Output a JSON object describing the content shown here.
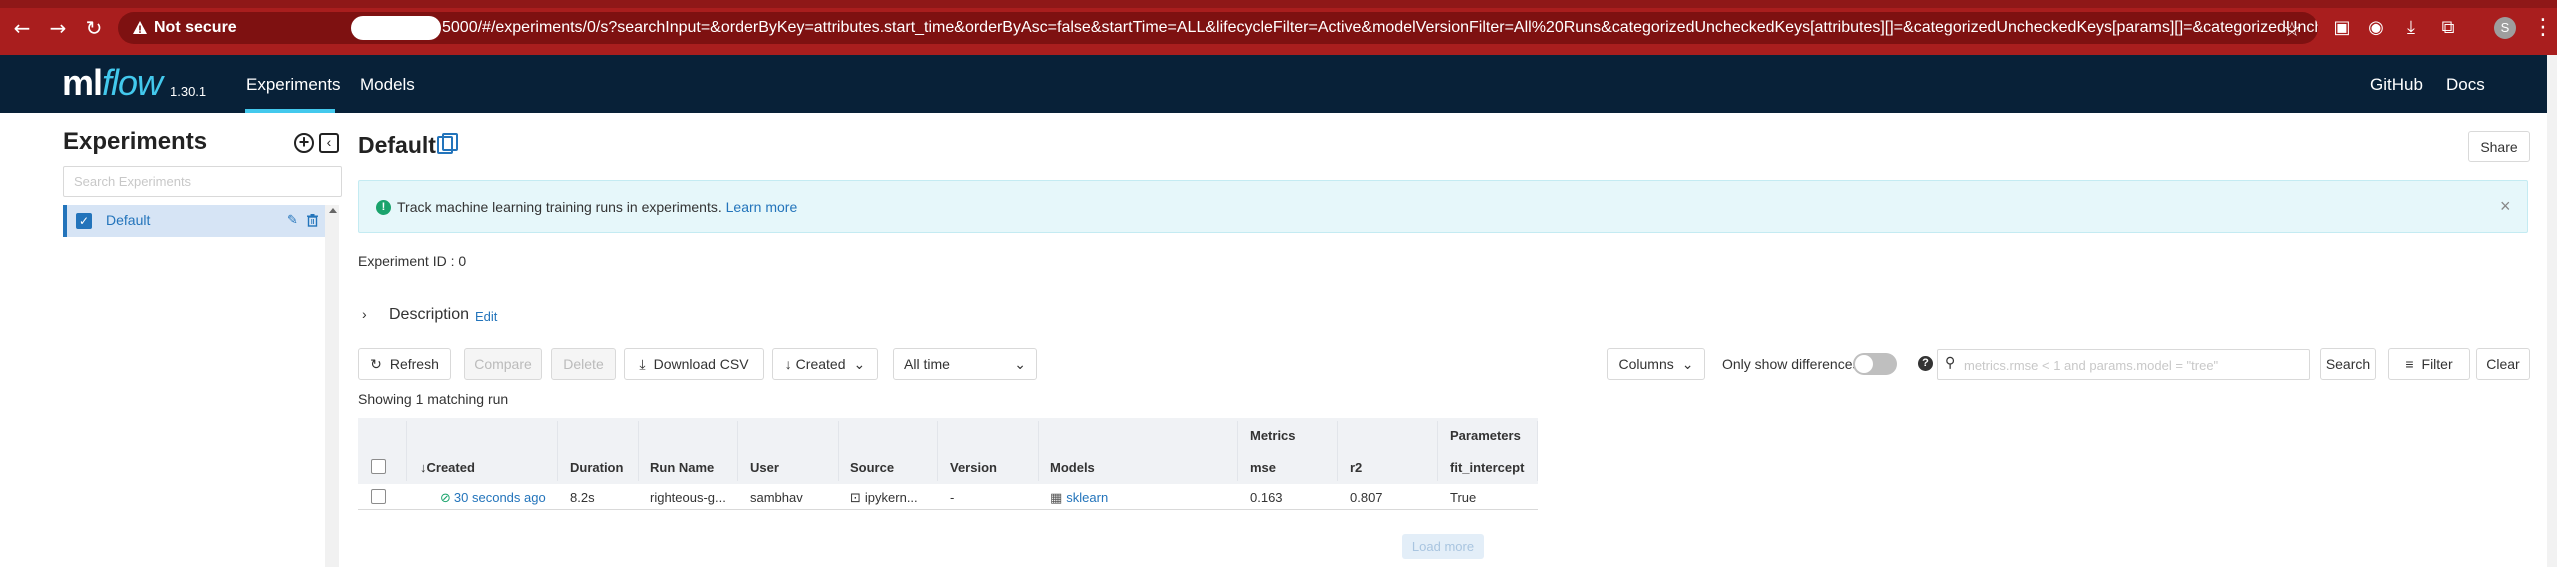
{
  "browser": {
    "not_secure": "Not secure",
    "url": "5000/#/experiments/0/s?searchInput=&orderByKey=attributes.start_time&orderByAsc=false&startTime=ALL&lifecycleFilter=Active&modelVersionFilter=All%20Runs&categorizedUncheckedKeys[attributes][]=&categorizedUncheckedKeys[params][]=&categorizedUncheckedKeys[metrics][]=&categorized...",
    "profile_initial": "S",
    "icons": [
      "back-icon",
      "forward-icon",
      "reload-icon",
      "star-icon",
      "extension-icon",
      "download-icon",
      "puzzle-icon",
      "kebab-icon"
    ]
  },
  "header": {
    "logo_ml": "ml",
    "logo_flow": "flow",
    "version": "1.30.1",
    "nav": [
      "Experiments",
      "Models"
    ],
    "right": [
      "GitHub",
      "Docs"
    ],
    "brand_color": "#082138",
    "accent_color": "#43c9ed"
  },
  "sidebar": {
    "title": "Experiments",
    "search_placeholder": "Search Experiments",
    "items": [
      {
        "label": "Default"
      }
    ]
  },
  "main": {
    "title": "Default",
    "share_label": "Share",
    "alert_text": "Track machine learning training runs in experiments.",
    "alert_link": "Learn more",
    "experiment_id": "Experiment ID :  0",
    "description_label": "Description",
    "description_edit": "Edit",
    "toolbar": {
      "refresh": "Refresh",
      "compare": "Compare",
      "delete": "Delete",
      "download": "Download CSV",
      "sort": "Created",
      "time": "All time",
      "columns": "Columns",
      "only_diff": "Only show differences",
      "search_placeholder": "metrics.rmse < 1 and params.model = \"tree\"",
      "search_btn": "Search",
      "filter_btn": "Filter",
      "clear_btn": "Clear"
    },
    "showing": "Showing 1 matching run",
    "table": {
      "groups": {
        "metrics": "Metrics",
        "parameters": "Parameters"
      },
      "headers": [
        "Created",
        "Duration",
        "Run Name",
        "User",
        "Source",
        "Version",
        "Models",
        "mse",
        "r2",
        "fit_intercept"
      ],
      "rows": [
        {
          "created": "30 seconds ago",
          "duration": "8.2s",
          "run_name": "righteous-g...",
          "user": "sambhav",
          "source": "ipykern...",
          "version": "-",
          "models": "sklearn",
          "mse": "0.163",
          "r2": "0.807",
          "fit_intercept": "True"
        }
      ],
      "load_more": "Load more"
    }
  }
}
